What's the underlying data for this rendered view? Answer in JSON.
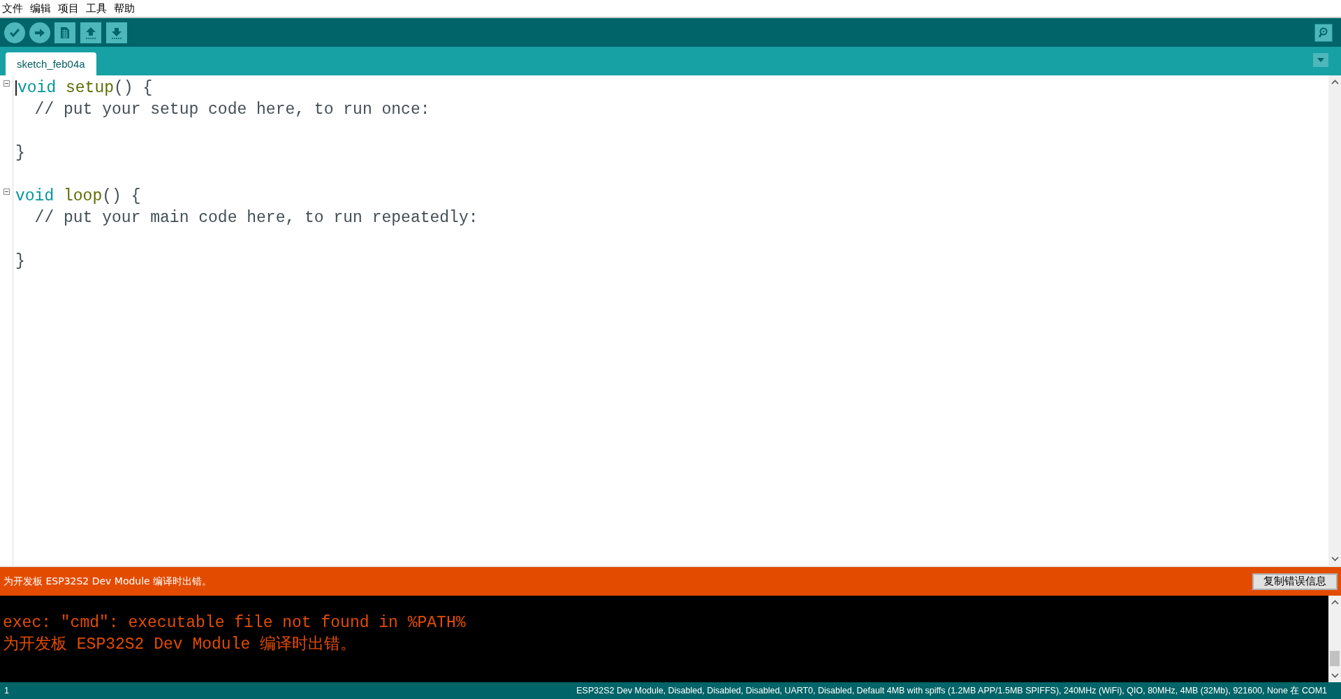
{
  "menu": [
    "文件",
    "编辑",
    "项目",
    "工具",
    "帮助"
  ],
  "toolbar": [
    {
      "kind": "verify"
    },
    {
      "kind": "upload"
    },
    {
      "kind": "new"
    },
    {
      "kind": "open"
    },
    {
      "kind": "save"
    }
  ],
  "tabs": [
    {
      "label": "sketch_feb04a",
      "selected": true
    }
  ],
  "editor": {
    "lines": [
      {
        "fold": true,
        "tokens": [
          {
            "kind": "keyword",
            "text": "void"
          },
          {
            "kind": "function",
            "text": "setup"
          },
          {
            "kind": "plain",
            "text": "() {"
          }
        ]
      },
      {
        "fold": false,
        "tokens": [
          {
            "kind": "comment",
            "text": "  // put your setup code here, to run once:"
          }
        ]
      },
      {
        "fold": false
      },
      {
        "fold": false,
        "tokens": [
          {
            "kind": "plain",
            "text": "}"
          }
        ]
      },
      {
        "fold": false
      },
      {
        "fold": true,
        "tokens": [
          {
            "kind": "keyword",
            "text": "void"
          },
          {
            "kind": "function",
            "text": "loop"
          },
          {
            "kind": "plain",
            "text": "() {"
          }
        ]
      },
      {
        "fold": false,
        "tokens": [
          {
            "kind": "comment",
            "text": "  // put your main code here, to run repeatedly:"
          }
        ]
      },
      {
        "fold": false
      },
      {
        "fold": false,
        "tokens": [
          {
            "kind": "plain",
            "text": "}"
          }
        ]
      }
    ]
  },
  "error_bar": {
    "message": "为开发板 ESP32S2 Dev Module 编译时出错。",
    "button": "复制错误信息"
  },
  "console": {
    "lines": [
      "exec: \"cmd\": executable file not found in %PATH%",
      "为开发板 ESP32S2 Dev Module 编译时出错。"
    ]
  },
  "status_bar": {
    "line": "1",
    "board": "ESP32S2 Dev Module, Disabled, Disabled, Disabled, UART0, Disabled, Default 4MB with spiffs (1.2MB APP/1.5MB SPIFFS), 240MHz (WiFi), QIO, 80MHz, 4MB (32Mb), 921600, None 在 COM1"
  }
}
